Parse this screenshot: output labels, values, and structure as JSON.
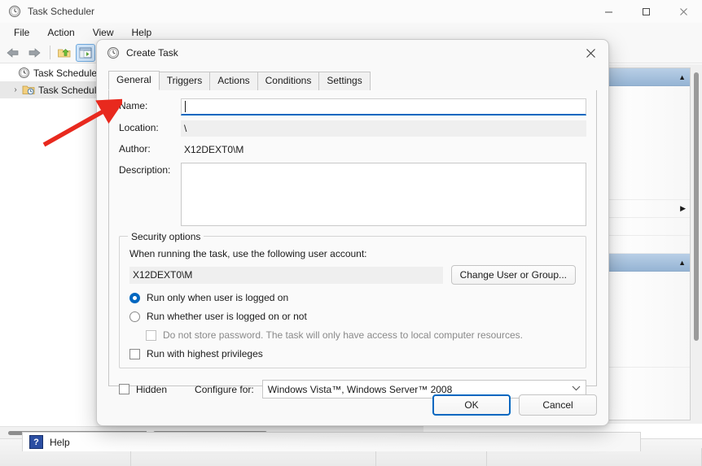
{
  "window": {
    "title": "Task Scheduler",
    "icon": "clock-icon",
    "controls": {
      "minimize": "—",
      "maximize": "□",
      "close": "✕"
    }
  },
  "menubar": {
    "items": [
      {
        "label": "File"
      },
      {
        "label": "Action"
      },
      {
        "label": "View"
      },
      {
        "label": "Help"
      }
    ]
  },
  "toolbar": {
    "back": "back-arrow",
    "forward": "forward-arrow",
    "up_folder": "folder-up-icon",
    "show_tree": "show-console-tree-icon"
  },
  "tree": {
    "items": [
      {
        "label": "Task Scheduler (L",
        "icon": "clock-icon",
        "arrow": ""
      },
      {
        "label": "Task Schedule",
        "icon": "folder-clock-icon",
        "arrow": "›"
      }
    ]
  },
  "actions_pane": {
    "caret": "▲",
    "sub_caret": "▶"
  },
  "statusbar": {
    "help_label": "Help",
    "help_icon": "?"
  },
  "dialog": {
    "title": "Create Task",
    "icon": "clock-icon",
    "close_label": "✕",
    "tabs": [
      {
        "label": "General",
        "active": true
      },
      {
        "label": "Triggers",
        "active": false
      },
      {
        "label": "Actions",
        "active": false
      },
      {
        "label": "Conditions",
        "active": false
      },
      {
        "label": "Settings",
        "active": false
      }
    ],
    "general": {
      "name_label": "Name:",
      "name_value": "",
      "location_label": "Location:",
      "location_value": "\\",
      "author_label": "Author:",
      "author_value": "X12DEXT0\\M",
      "description_label": "Description:",
      "description_value": "",
      "security": {
        "group_title": "Security options",
        "account_prompt": "When running the task, use the following user account:",
        "account_value": "X12DEXT0\\M",
        "change_user_button": "Change User or Group...",
        "run_logged_on": "Run only when user is logged on",
        "run_logged_on_checked": true,
        "run_whether": "Run whether user is logged on or not",
        "run_whether_checked": false,
        "no_store_password": "Do not store password.  The task will only have access to local computer resources.",
        "no_store_password_checked": false,
        "highest_privileges": "Run with highest privileges",
        "highest_privileges_checked": false
      },
      "hidden_label": "Hidden",
      "hidden_checked": false,
      "configure_for_label": "Configure for:",
      "configure_for_value": "Windows Vista™, Windows Server™ 2008",
      "configure_for_chevron": "∨"
    },
    "buttons": {
      "ok": "OK",
      "cancel": "Cancel"
    }
  },
  "annotation": {
    "color": "#e8291e",
    "type": "arrow-pointing-to-name-field"
  },
  "colors": {
    "accent": "#0067c0",
    "annotation_red": "#e8291e",
    "actions_header": "#95b4d4"
  }
}
